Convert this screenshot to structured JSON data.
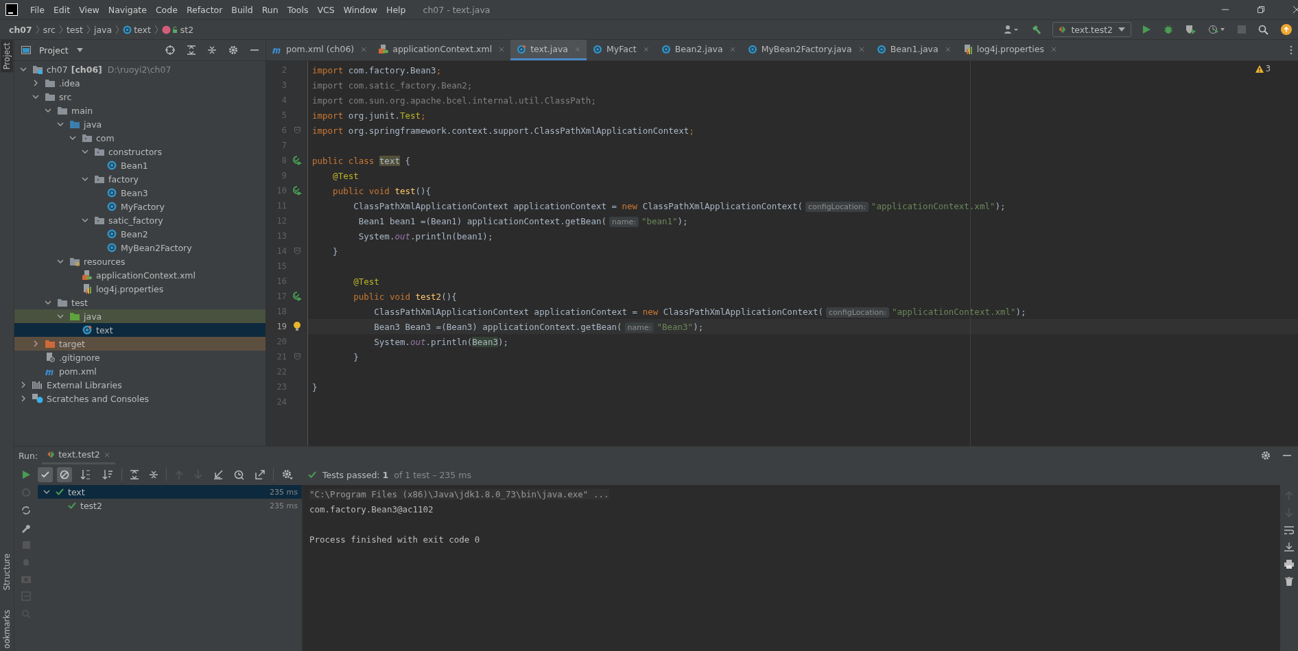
{
  "menu": [
    "File",
    "Edit",
    "View",
    "Navigate",
    "Code",
    "Refactor",
    "Build",
    "Run",
    "Tools",
    "VCS",
    "Window",
    "Help"
  ],
  "window": {
    "title": "ch07 - text.java"
  },
  "breadcrumb": [
    {
      "label": "ch07",
      "kind": "project"
    },
    {
      "label": "src",
      "kind": "dir"
    },
    {
      "label": "test",
      "kind": "dir"
    },
    {
      "label": "java",
      "kind": "dir"
    },
    {
      "label": "text",
      "kind": "class"
    },
    {
      "label": "st2",
      "kind": "method"
    }
  ],
  "run_config": "text.test2",
  "side_strip": [
    {
      "label": "Project",
      "selected": true
    },
    {
      "label": "Structure",
      "selected": false
    },
    {
      "label": "ookmarks",
      "selected": false
    }
  ],
  "project_panel": {
    "title": "Project",
    "tree": [
      {
        "label": "ch07",
        "tag": "[ch06]",
        "path": "D:\\ruoyi2\\ch07",
        "kind": "module",
        "expanded": true,
        "selected": false,
        "children": [
          {
            "label": ".idea",
            "kind": "folder",
            "expanded": false,
            "selected": false
          },
          {
            "label": "src",
            "kind": "folder",
            "expanded": true,
            "selected": false,
            "children": [
              {
                "label": "main",
                "kind": "folder",
                "expanded": true,
                "selected": false,
                "children": [
                  {
                    "label": "java",
                    "kind": "source",
                    "expanded": true,
                    "selected": false,
                    "children": [
                      {
                        "label": "com",
                        "kind": "package",
                        "expanded": true,
                        "selected": false,
                        "children": [
                          {
                            "label": "constructors",
                            "kind": "package",
                            "expanded": true,
                            "selected": false,
                            "children": [
                              {
                                "label": "Bean1",
                                "kind": "class",
                                "selected": false
                              }
                            ]
                          },
                          {
                            "label": "factory",
                            "kind": "package",
                            "expanded": true,
                            "selected": false,
                            "children": [
                              {
                                "label": "Bean3",
                                "kind": "class",
                                "selected": false
                              },
                              {
                                "label": "MyFactory",
                                "kind": "class",
                                "selected": false
                              }
                            ]
                          },
                          {
                            "label": "satic_factory",
                            "kind": "package",
                            "expanded": true,
                            "selected": false,
                            "children": [
                              {
                                "label": "Bean2",
                                "kind": "class",
                                "selected": false
                              },
                              {
                                "label": "MyBean2Factory",
                                "kind": "class",
                                "selected": false
                              }
                            ]
                          }
                        ]
                      }
                    ]
                  },
                  {
                    "label": "resources",
                    "kind": "resources",
                    "expanded": true,
                    "selected": false,
                    "children": [
                      {
                        "label": "applicationContext.xml",
                        "kind": "xml",
                        "selected": false
                      },
                      {
                        "label": "log4j.properties",
                        "kind": "props",
                        "selected": false
                      }
                    ]
                  }
                ]
              },
              {
                "label": "test",
                "kind": "folder",
                "expanded": true,
                "selected": false,
                "children": [
                  {
                    "label": "java",
                    "kind": "testsource",
                    "expanded": true,
                    "selected": false,
                    "children": [
                      {
                        "label": "text",
                        "kind": "testclass",
                        "selected": true
                      }
                    ]
                  }
                ]
              }
            ]
          },
          {
            "label": "target",
            "kind": "excluded",
            "expanded": false,
            "selected": false
          },
          {
            "label": ".gitignore",
            "kind": "git",
            "selected": false
          },
          {
            "label": "pom.xml",
            "kind": "maven",
            "selected": false
          }
        ]
      },
      {
        "label": "External Libraries",
        "kind": "libs",
        "expanded": false,
        "selected": false
      },
      {
        "label": "Scratches and Consoles",
        "kind": "scratch",
        "expanded": false,
        "selected": false
      }
    ]
  },
  "tabs": [
    {
      "label": "pom.xml (ch06)",
      "kind": "maven",
      "selected": false
    },
    {
      "label": "applicationContext.xml",
      "kind": "xml",
      "selected": false
    },
    {
      "label": "text.java",
      "kind": "testclass",
      "selected": true
    },
    {
      "label": "MyFact",
      "kind": "class",
      "selected": false
    },
    {
      "label": "Bean2.java",
      "kind": "class",
      "selected": false
    },
    {
      "label": "MyBean2Factory.java",
      "kind": "class",
      "selected": false
    },
    {
      "label": "Bean1.java",
      "kind": "class",
      "selected": false
    },
    {
      "label": "log4j.properties",
      "kind": "props",
      "selected": false
    }
  ],
  "editor": {
    "warnings": "3",
    "lines": [
      {
        "n": "2",
        "current": false,
        "segs": [
          {
            "kind": "kw",
            "t": "import "
          },
          {
            "kind": "p",
            "t": "com.factory.Bean3"
          },
          {
            "kind": "kw",
            "t": ";"
          }
        ]
      },
      {
        "n": "3",
        "current": false,
        "segs": [
          {
            "kind": "dim",
            "t": "import com.satic_factory.Bean2;"
          }
        ]
      },
      {
        "n": "4",
        "current": false,
        "segs": [
          {
            "kind": "dim",
            "t": "import com.sun.org.apache.bcel.internal.util.ClassPath;"
          }
        ]
      },
      {
        "n": "5",
        "current": false,
        "segs": [
          {
            "kind": "kw",
            "t": "import "
          },
          {
            "kind": "p",
            "t": "org.junit."
          },
          {
            "kind": "ann",
            "t": "Test"
          },
          {
            "kind": "kw",
            "t": ";"
          }
        ]
      },
      {
        "n": "6",
        "kind": "fold",
        "current": false,
        "segs": [
          {
            "kind": "kw",
            "t": "import "
          },
          {
            "kind": "p",
            "t": "org.springframework.context.support.ClassPathXmlApplicationContext"
          },
          {
            "kind": "kw",
            "t": ";"
          }
        ]
      },
      {
        "n": "7",
        "current": false
      },
      {
        "n": "8",
        "kind": "run",
        "current": false,
        "segs": [
          {
            "kind": "kw",
            "t": "public class "
          },
          {
            "kind": "mark",
            "t": "text"
          },
          {
            "kind": "p",
            "t": " {"
          }
        ]
      },
      {
        "n": "9",
        "current": false,
        "segs": [
          {
            "kind": "ann",
            "t": "    @Test"
          }
        ]
      },
      {
        "n": "10",
        "kind": "run",
        "current": false,
        "segs": [
          {
            "kind": "kw",
            "t": "    public void "
          },
          {
            "kind": "fn",
            "t": "test"
          },
          {
            "kind": "p",
            "t": "(){"
          }
        ]
      },
      {
        "n": "11",
        "current": false,
        "segs": [
          {
            "kind": "p",
            "t": "        ClassPathXmlApplicationContext applicationContext = "
          },
          {
            "kind": "kw",
            "t": "new "
          },
          {
            "kind": "p",
            "t": "ClassPathXmlApplicationContext("
          },
          {
            "kind": "hint",
            "t": "configLocation:"
          },
          {
            "kind": "str",
            "t": "\"applicationContext.xml\""
          },
          {
            "kind": "p",
            "t": ");"
          }
        ]
      },
      {
        "n": "12",
        "current": false,
        "segs": [
          {
            "kind": "p",
            "t": "         Bean1 bean1 =(Bean1) applicationContext.getBean("
          },
          {
            "kind": "hint",
            "t": "name:"
          },
          {
            "kind": "str",
            "t": "\"bean1\""
          },
          {
            "kind": "p",
            "t": ");"
          }
        ]
      },
      {
        "n": "13",
        "current": false,
        "segs": [
          {
            "kind": "p",
            "t": "         System."
          },
          {
            "kind": "field",
            "t": "out"
          },
          {
            "kind": "p",
            "t": ".println(bean1);"
          }
        ]
      },
      {
        "n": "14",
        "kind": "fold",
        "current": false,
        "segs": [
          {
            "kind": "p",
            "t": "    }"
          }
        ]
      },
      {
        "n": "15",
        "current": false
      },
      {
        "n": "16",
        "current": false,
        "segs": [
          {
            "kind": "ann",
            "t": "        @Test"
          }
        ]
      },
      {
        "n": "17",
        "kind": "run",
        "current": false,
        "segs": [
          {
            "kind": "kw",
            "t": "        public void "
          },
          {
            "kind": "fn",
            "t": "test2"
          },
          {
            "kind": "p",
            "t": "(){"
          }
        ]
      },
      {
        "n": "18",
        "current": false,
        "segs": [
          {
            "kind": "p",
            "t": "            ClassPathXmlApplicationContext applicationContext = "
          },
          {
            "kind": "kw",
            "t": "new "
          },
          {
            "kind": "p",
            "t": "ClassPathXmlApplicationContext("
          },
          {
            "kind": "hint",
            "t": "configLocation:"
          },
          {
            "kind": "str",
            "t": "\"applicationContext.xml\""
          },
          {
            "kind": "p",
            "t": ");"
          }
        ]
      },
      {
        "n": "19",
        "kind": "bulb",
        "current": true,
        "segs": [
          {
            "kind": "p",
            "t": "            Bean3 Bean3 =(Bean3) applicationContext.getBean("
          },
          {
            "kind": "hint",
            "t": "name:"
          },
          {
            "kind": "str",
            "t": "\"Bean3\""
          },
          {
            "kind": "p",
            "t": ");"
          }
        ]
      },
      {
        "n": "20",
        "current": false,
        "segs": [
          {
            "kind": "p",
            "t": "            System."
          },
          {
            "kind": "field",
            "t": "out"
          },
          {
            "kind": "p",
            "t": ".println("
          },
          {
            "kind": "usage",
            "t": "Bean3"
          },
          {
            "kind": "p",
            "t": ");"
          }
        ]
      },
      {
        "n": "21",
        "kind": "fold",
        "current": false,
        "segs": [
          {
            "kind": "p",
            "t": "        }"
          }
        ]
      },
      {
        "n": "22",
        "current": false
      },
      {
        "n": "23",
        "current": false,
        "segs": [
          {
            "kind": "p",
            "t": "}"
          }
        ]
      },
      {
        "n": "24",
        "current": false
      }
    ]
  },
  "run_panel": {
    "label": "Run:",
    "tab": "text.test2",
    "status": "Tests passed: **1**",
    "status_detail": "of 1 test – 235 ms",
    "tests": [
      {
        "label": "text",
        "time": "235 ms",
        "selected": true,
        "expanded": true,
        "children": [
          {
            "label": "test2",
            "time": "235 ms",
            "selected": false
          }
        ]
      }
    ],
    "console": [
      {
        "kind": "command",
        "text": "\"C:\\Program Files (x86)\\Java\\jdk1.8.0_73\\bin\\java.exe\" ..."
      },
      {
        "kind": "output",
        "text": "com.factory.Bean3@ac1102"
      },
      {
        "kind": "exit",
        "text": "Process finished with exit code 0"
      }
    ]
  }
}
